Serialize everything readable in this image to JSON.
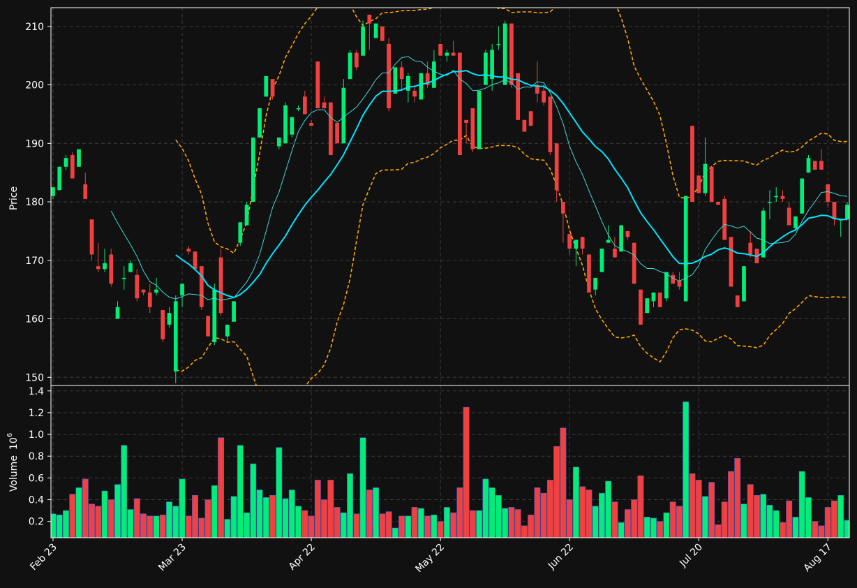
{
  "chart_data": {
    "type": "candlestick",
    "colors": {
      "background": "#111111",
      "up": "#00ee77",
      "down": "#f04040",
      "grid": "#3a3a3a",
      "ma_fast": "#40d8d8",
      "ma_slow": "#00e5ff",
      "bands": "#ffa500",
      "text": "#ffffff"
    },
    "price_panel": {
      "ylabel": "Price",
      "ylim": [
        148.6,
        213.2
      ],
      "yticks": [
        150,
        160,
        170,
        180,
        190,
        200,
        210
      ]
    },
    "volume_panel": {
      "ylabel": "Volume",
      "ylabel_exponent": "6",
      "ylabel_base": "10",
      "ylim": [
        0.05,
        1.45
      ],
      "yticks": [
        0.2,
        0.4,
        0.6,
        0.8,
        1.0,
        1.2,
        1.4
      ],
      "ytick_labels": [
        "0.2",
        "0.4",
        "0.6",
        "0.8",
        "1.0",
        "1.2",
        "1.4"
      ]
    },
    "x_ticks": [
      {
        "index": 0,
        "label": "Feb 23"
      },
      {
        "index": 20,
        "label": "Mar 23"
      },
      {
        "index": 40,
        "label": "Apr 22"
      },
      {
        "index": 60,
        "label": "May 22"
      },
      {
        "index": 80,
        "label": "Jun 22"
      },
      {
        "index": 100,
        "label": "Jul 20"
      },
      {
        "index": 120,
        "label": "Aug 17"
      }
    ],
    "ohlc": [
      [
        181,
        182,
        180.5,
        182.5
      ],
      [
        182,
        186,
        182,
        186
      ],
      [
        186,
        188,
        185.5,
        187.5
      ],
      [
        188,
        188.5,
        184,
        184
      ],
      [
        186,
        189,
        186,
        189
      ],
      [
        183,
        185,
        180.5,
        180.5
      ],
      [
        177,
        177,
        170,
        171
      ],
      [
        169,
        173,
        168,
        168.5
      ],
      [
        168.5,
        172,
        168,
        169.5
      ],
      [
        171,
        172,
        165.5,
        166
      ],
      [
        160,
        163,
        160,
        162
      ],
      [
        167,
        169,
        165,
        167
      ],
      [
        168,
        170,
        168,
        169.5
      ],
      [
        167.5,
        168.5,
        163,
        163.5
      ],
      [
        165,
        165,
        164,
        164.5
      ],
      [
        164.5,
        166,
        161,
        162
      ],
      [
        164.5,
        167,
        164,
        165
      ],
      [
        161.5,
        161.5,
        156,
        156.5
      ],
      [
        159,
        162,
        158.5,
        161
      ],
      [
        151,
        164,
        149,
        163
      ],
      [
        164,
        166,
        162,
        166
      ],
      [
        172,
        172.5,
        171,
        171.5
      ],
      [
        171.5,
        171.5,
        168.5,
        168.5
      ],
      [
        169,
        169,
        161.5,
        162
      ],
      [
        160.5,
        160.5,
        157,
        157
      ],
      [
        156,
        166,
        155.5,
        165
      ],
      [
        170.5,
        172,
        160.5,
        161
      ],
      [
        157,
        159,
        156,
        159
      ],
      [
        159.5,
        163,
        159.5,
        163
      ],
      [
        173,
        176.5,
        172.5,
        176.5
      ],
      [
        176,
        180,
        176,
        179.5
      ],
      [
        180,
        191,
        180,
        191
      ],
      [
        191,
        196,
        191,
        196
      ],
      [
        198,
        201.5,
        198,
        201.5
      ],
      [
        201,
        201,
        197.5,
        198
      ],
      [
        189.5,
        191,
        189,
        191
      ],
      [
        190,
        197,
        190,
        196.5
      ],
      [
        191.5,
        194.5,
        191,
        194.5
      ],
      [
        196,
        196.5,
        195.5,
        196
      ],
      [
        198,
        199,
        195,
        195
      ],
      [
        193.5,
        194,
        193,
        193
      ],
      [
        204,
        204,
        196,
        196
      ],
      [
        197,
        198,
        196,
        196
      ],
      [
        197,
        197,
        188,
        188
      ],
      [
        193.5,
        193.5,
        190,
        190
      ],
      [
        190,
        201,
        190,
        199.5
      ],
      [
        201,
        206,
        201,
        205.5
      ],
      [
        205.5,
        206,
        202.5,
        203
      ],
      [
        205,
        211,
        205,
        210
      ],
      [
        212,
        212,
        206,
        210.5
      ],
      [
        208,
        210.5,
        208,
        210.5
      ],
      [
        210,
        210,
        207.5,
        207.5
      ],
      [
        207,
        208,
        195.5,
        196
      ],
      [
        198.5,
        203,
        198.5,
        203
      ],
      [
        203,
        204,
        199,
        201
      ],
      [
        199,
        202,
        197,
        201.5
      ],
      [
        199,
        200,
        197,
        198
      ],
      [
        197.5,
        202,
        197.5,
        202
      ],
      [
        202,
        204,
        199.5,
        200
      ],
      [
        199.5,
        206,
        199.5,
        204
      ],
      [
        207,
        207,
        205,
        205
      ],
      [
        205,
        206,
        204,
        205.5
      ],
      [
        205.5,
        207.5,
        205,
        205
      ],
      [
        205.5,
        205.5,
        188,
        188
      ],
      [
        194,
        194,
        190,
        193.5
      ],
      [
        196,
        196,
        188.5,
        189
      ],
      [
        189,
        199,
        189,
        199
      ],
      [
        200,
        206,
        200,
        205.5
      ],
      [
        201,
        207,
        199,
        206
      ],
      [
        207,
        210,
        206,
        207
      ],
      [
        200,
        211,
        200,
        210.5
      ],
      [
        210.5,
        210.5,
        199.5,
        200
      ],
      [
        202,
        202,
        194,
        194
      ],
      [
        194,
        194,
        192,
        192
      ],
      [
        195.5,
        195.5,
        193,
        193
      ],
      [
        200,
        204,
        197,
        198.5
      ],
      [
        199,
        200,
        196.5,
        197
      ],
      [
        198,
        198,
        188,
        188.5
      ],
      [
        190,
        190,
        180,
        182
      ],
      [
        180,
        180,
        173,
        178
      ],
      [
        174.5,
        174.5,
        171,
        172
      ],
      [
        172,
        173,
        169,
        173.5
      ],
      [
        174,
        174,
        171,
        172
      ],
      [
        171,
        171,
        164.5,
        164.5
      ],
      [
        165,
        167,
        164,
        167
      ],
      [
        168,
        172,
        168,
        172
      ],
      [
        173,
        176,
        173,
        173.5
      ],
      [
        172,
        174,
        170.5,
        170.5
      ],
      [
        171.5,
        176,
        171.5,
        176
      ],
      [
        175,
        175,
        173.5,
        174
      ],
      [
        173,
        173,
        166,
        166
      ],
      [
        165,
        165,
        159,
        159
      ],
      [
        161,
        163.5,
        161,
        163.5
      ],
      [
        163,
        164.5,
        162,
        164.5
      ],
      [
        164.5,
        164.5,
        162,
        162
      ],
      [
        163.5,
        168,
        163,
        168
      ],
      [
        167.5,
        168,
        166,
        166
      ],
      [
        166.5,
        168,
        165,
        165.5
      ],
      [
        163,
        181,
        163,
        181
      ],
      [
        193,
        193,
        180,
        180
      ],
      [
        184.5,
        184.5,
        181.5,
        181.5
      ],
      [
        181.5,
        191,
        181,
        186.5
      ],
      [
        186,
        186,
        180,
        180
      ],
      [
        180,
        180,
        179.5,
        179.5
      ],
      [
        180.5,
        181,
        173.5,
        173.5
      ],
      [
        174,
        174,
        165.5,
        165.5
      ],
      [
        164,
        164,
        162,
        162
      ],
      [
        163,
        169,
        163,
        169
      ],
      [
        173,
        175,
        170.5,
        171
      ],
      [
        172,
        172,
        169.5,
        169.5
      ],
      [
        170.5,
        179,
        170.5,
        178.5
      ],
      [
        180,
        182,
        177,
        180
      ],
      [
        181,
        182.5,
        180,
        181
      ],
      [
        181,
        182,
        180,
        180.5
      ],
      [
        179,
        180,
        176,
        176
      ],
      [
        175.5,
        177.5,
        175,
        177.5
      ],
      [
        178,
        184,
        178,
        184
      ],
      [
        185,
        188,
        185,
        187.5
      ],
      [
        187,
        187,
        185.5,
        185.5
      ],
      [
        187,
        189,
        185.5,
        185.5
      ],
      [
        183,
        183,
        179,
        180
      ],
      [
        180,
        180,
        176,
        177
      ],
      [
        177,
        177,
        174,
        177
      ],
      [
        177,
        180,
        177,
        179.5
      ]
    ],
    "volume": [
      0.27,
      0.26,
      0.3,
      0.45,
      0.51,
      0.59,
      0.36,
      0.34,
      0.48,
      0.4,
      0.54,
      0.9,
      0.31,
      0.41,
      0.27,
      0.25,
      0.25,
      0.26,
      0.38,
      0.34,
      0.59,
      0.25,
      0.44,
      0.23,
      0.4,
      0.53,
      0.97,
      0.22,
      0.43,
      0.9,
      0.28,
      0.73,
      0.49,
      0.42,
      0.44,
      0.88,
      0.41,
      0.49,
      0.34,
      0.3,
      0.25,
      0.58,
      0.4,
      0.58,
      0.33,
      0.28,
      0.64,
      0.27,
      0.97,
      0.49,
      0.51,
      0.27,
      0.29,
      0.14,
      0.25,
      0.25,
      0.33,
      0.32,
      0.25,
      0.26,
      0.2,
      0.33,
      0.28,
      0.51,
      1.25,
      0.3,
      0.3,
      0.59,
      0.51,
      0.44,
      0.32,
      0.33,
      0.31,
      0.16,
      0.26,
      0.51,
      0.46,
      0.58,
      0.89,
      1.06,
      0.4,
      0.7,
      0.52,
      0.49,
      0.34,
      0.46,
      0.57,
      0.38,
      0.19,
      0.31,
      0.4,
      0.62,
      0.24,
      0.23,
      0.2,
      0.28,
      0.38,
      0.34,
      1.3,
      0.64,
      0.58,
      0.43,
      0.56,
      0.17,
      0.38,
      0.66,
      0.78,
      0.36,
      0.54,
      0.44,
      0.45,
      0.35,
      0.3,
      0.19,
      0.39,
      0.24,
      0.66,
      0.42,
      0.2,
      0.16,
      0.33,
      0.39,
      0.44,
      0.21
    ],
    "ma_fast_start": 8,
    "ma_fast_window": 10,
    "ma_slow_start": 19,
    "ma_slow_window": 20,
    "bands_start": 19
  }
}
